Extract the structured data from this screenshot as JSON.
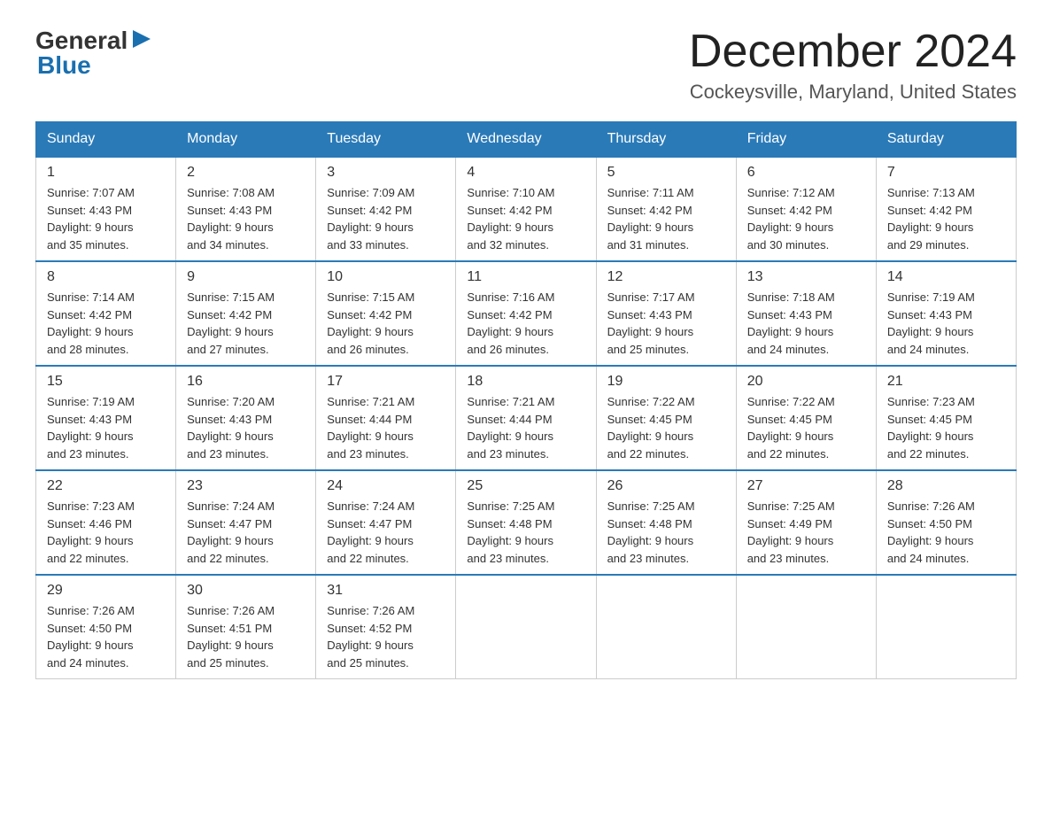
{
  "logo": {
    "text_general": "General",
    "text_blue": "Blue",
    "arrow": "▶"
  },
  "header": {
    "month": "December 2024",
    "location": "Cockeysville, Maryland, United States"
  },
  "days_of_week": [
    "Sunday",
    "Monday",
    "Tuesday",
    "Wednesday",
    "Thursday",
    "Friday",
    "Saturday"
  ],
  "weeks": [
    [
      {
        "day": "1",
        "sunrise": "7:07 AM",
        "sunset": "4:43 PM",
        "daylight": "9 hours and 35 minutes."
      },
      {
        "day": "2",
        "sunrise": "7:08 AM",
        "sunset": "4:43 PM",
        "daylight": "9 hours and 34 minutes."
      },
      {
        "day": "3",
        "sunrise": "7:09 AM",
        "sunset": "4:42 PM",
        "daylight": "9 hours and 33 minutes."
      },
      {
        "day": "4",
        "sunrise": "7:10 AM",
        "sunset": "4:42 PM",
        "daylight": "9 hours and 32 minutes."
      },
      {
        "day": "5",
        "sunrise": "7:11 AM",
        "sunset": "4:42 PM",
        "daylight": "9 hours and 31 minutes."
      },
      {
        "day": "6",
        "sunrise": "7:12 AM",
        "sunset": "4:42 PM",
        "daylight": "9 hours and 30 minutes."
      },
      {
        "day": "7",
        "sunrise": "7:13 AM",
        "sunset": "4:42 PM",
        "daylight": "9 hours and 29 minutes."
      }
    ],
    [
      {
        "day": "8",
        "sunrise": "7:14 AM",
        "sunset": "4:42 PM",
        "daylight": "9 hours and 28 minutes."
      },
      {
        "day": "9",
        "sunrise": "7:15 AM",
        "sunset": "4:42 PM",
        "daylight": "9 hours and 27 minutes."
      },
      {
        "day": "10",
        "sunrise": "7:15 AM",
        "sunset": "4:42 PM",
        "daylight": "9 hours and 26 minutes."
      },
      {
        "day": "11",
        "sunrise": "7:16 AM",
        "sunset": "4:42 PM",
        "daylight": "9 hours and 26 minutes."
      },
      {
        "day": "12",
        "sunrise": "7:17 AM",
        "sunset": "4:43 PM",
        "daylight": "9 hours and 25 minutes."
      },
      {
        "day": "13",
        "sunrise": "7:18 AM",
        "sunset": "4:43 PM",
        "daylight": "9 hours and 24 minutes."
      },
      {
        "day": "14",
        "sunrise": "7:19 AM",
        "sunset": "4:43 PM",
        "daylight": "9 hours and 24 minutes."
      }
    ],
    [
      {
        "day": "15",
        "sunrise": "7:19 AM",
        "sunset": "4:43 PM",
        "daylight": "9 hours and 23 minutes."
      },
      {
        "day": "16",
        "sunrise": "7:20 AM",
        "sunset": "4:43 PM",
        "daylight": "9 hours and 23 minutes."
      },
      {
        "day": "17",
        "sunrise": "7:21 AM",
        "sunset": "4:44 PM",
        "daylight": "9 hours and 23 minutes."
      },
      {
        "day": "18",
        "sunrise": "7:21 AM",
        "sunset": "4:44 PM",
        "daylight": "9 hours and 23 minutes."
      },
      {
        "day": "19",
        "sunrise": "7:22 AM",
        "sunset": "4:45 PM",
        "daylight": "9 hours and 22 minutes."
      },
      {
        "day": "20",
        "sunrise": "7:22 AM",
        "sunset": "4:45 PM",
        "daylight": "9 hours and 22 minutes."
      },
      {
        "day": "21",
        "sunrise": "7:23 AM",
        "sunset": "4:45 PM",
        "daylight": "9 hours and 22 minutes."
      }
    ],
    [
      {
        "day": "22",
        "sunrise": "7:23 AM",
        "sunset": "4:46 PM",
        "daylight": "9 hours and 22 minutes."
      },
      {
        "day": "23",
        "sunrise": "7:24 AM",
        "sunset": "4:47 PM",
        "daylight": "9 hours and 22 minutes."
      },
      {
        "day": "24",
        "sunrise": "7:24 AM",
        "sunset": "4:47 PM",
        "daylight": "9 hours and 22 minutes."
      },
      {
        "day": "25",
        "sunrise": "7:25 AM",
        "sunset": "4:48 PM",
        "daylight": "9 hours and 23 minutes."
      },
      {
        "day": "26",
        "sunrise": "7:25 AM",
        "sunset": "4:48 PM",
        "daylight": "9 hours and 23 minutes."
      },
      {
        "day": "27",
        "sunrise": "7:25 AM",
        "sunset": "4:49 PM",
        "daylight": "9 hours and 23 minutes."
      },
      {
        "day": "28",
        "sunrise": "7:26 AM",
        "sunset": "4:50 PM",
        "daylight": "9 hours and 24 minutes."
      }
    ],
    [
      {
        "day": "29",
        "sunrise": "7:26 AM",
        "sunset": "4:50 PM",
        "daylight": "9 hours and 24 minutes."
      },
      {
        "day": "30",
        "sunrise": "7:26 AM",
        "sunset": "4:51 PM",
        "daylight": "9 hours and 25 minutes."
      },
      {
        "day": "31",
        "sunrise": "7:26 AM",
        "sunset": "4:52 PM",
        "daylight": "9 hours and 25 minutes."
      },
      null,
      null,
      null,
      null
    ]
  ],
  "labels": {
    "sunrise": "Sunrise:",
    "sunset": "Sunset:",
    "daylight": "Daylight:"
  }
}
